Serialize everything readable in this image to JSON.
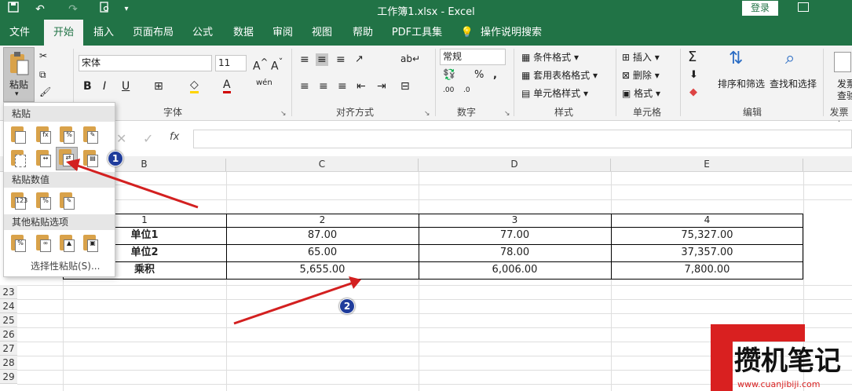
{
  "titlebar": {
    "doc_title": "工作簿1.xlsx  -  Excel",
    "login": "登录"
  },
  "tabs": [
    "文件",
    "开始",
    "插入",
    "页面布局",
    "公式",
    "数据",
    "审阅",
    "视图",
    "帮助",
    "PDF工具集",
    "操作说明搜索"
  ],
  "active_tab": "开始",
  "ribbon": {
    "paste_label": "粘贴",
    "font_name": "宋体",
    "font_size": "11",
    "font_group": "字体",
    "align_group": "对齐方式",
    "number_format": "常规",
    "number_group": "数字",
    "styles": {
      "conditional": "条件格式",
      "table_format": "套用表格格式",
      "cell_style": "单元格样式",
      "group": "样式"
    },
    "cells": {
      "insert": "插入",
      "delete": "删除",
      "format": "格式",
      "group": "单元格"
    },
    "edit": {
      "sort_filter": "排序和筛选",
      "find_select": "查找和选择",
      "group": "编辑"
    },
    "extra": {
      "line1": "发票",
      "line2": "查验",
      "group": "发票查"
    }
  },
  "formula": {
    "fx": "fx"
  },
  "paste_menu": {
    "section1": "粘贴",
    "section2": "粘贴数值",
    "section3": "其他粘贴选项",
    "special": "选择性粘贴(S)..."
  },
  "columns": [
    "B",
    "C",
    "D",
    "E"
  ],
  "row_numbers": [
    "23",
    "24",
    "25",
    "26",
    "27",
    "28",
    "29"
  ],
  "table": {
    "header": [
      "1",
      "2",
      "3",
      "4"
    ],
    "rows": [
      [
        "单位1",
        "87.00",
        "77.00",
        "75,327.00"
      ],
      [
        "单位2",
        "65.00",
        "78.00",
        "37,357.00"
      ],
      [
        "乘积",
        "5,655.00",
        "6,006.00",
        "7,800.00"
      ]
    ]
  },
  "badges": [
    "1",
    "2"
  ],
  "watermark": {
    "text": "攒机笔记",
    "url": "www.cuanjibiji.com"
  },
  "colors": {
    "excel_green": "#217346",
    "arrow_red": "#d32020",
    "badge_blue": "#1f3c9b"
  }
}
